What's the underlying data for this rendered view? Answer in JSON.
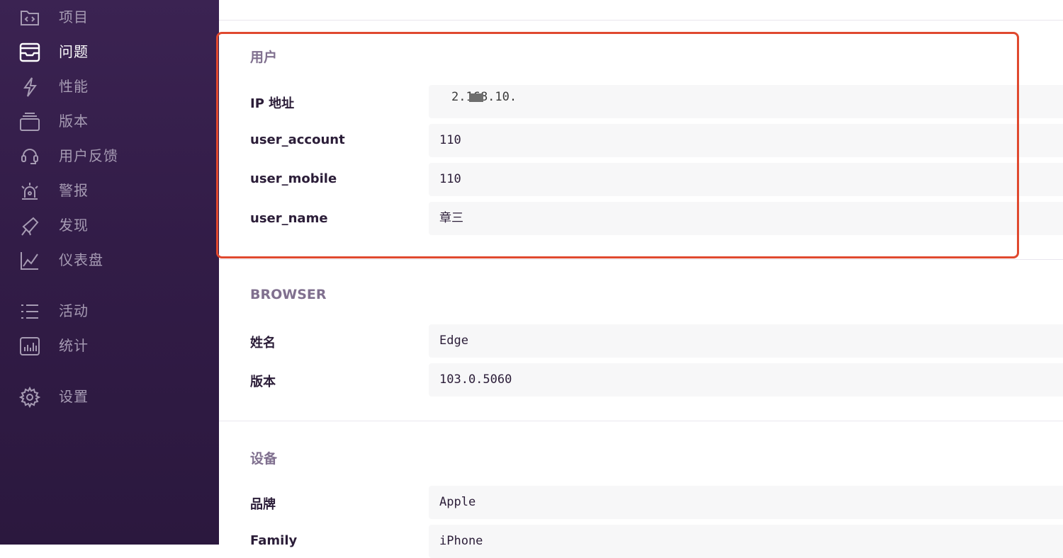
{
  "sidebar": {
    "items": [
      {
        "label": "项目",
        "icon": "code-folder-icon"
      },
      {
        "label": "问题",
        "icon": "inbox-icon",
        "active": true
      },
      {
        "label": "性能",
        "icon": "lightning-icon"
      },
      {
        "label": "版本",
        "icon": "releases-icon"
      },
      {
        "label": "用户反馈",
        "icon": "feedback-icon"
      },
      {
        "label": "警报",
        "icon": "siren-icon"
      },
      {
        "label": "发现",
        "icon": "telescope-icon"
      },
      {
        "label": "仪表盘",
        "icon": "graph-icon"
      },
      {
        "label": "活动",
        "icon": "list-icon"
      },
      {
        "label": "统计",
        "icon": "stats-icon"
      },
      {
        "label": "设置",
        "icon": "gear-icon"
      }
    ]
  },
  "sections": {
    "user": {
      "title": "用户",
      "fields": [
        {
          "key": "IP 地址",
          "value": "2.168.10."
        },
        {
          "key": "user_account",
          "value": "110"
        },
        {
          "key": "user_mobile",
          "value": "110"
        },
        {
          "key": "user_name",
          "value": "章三"
        }
      ]
    },
    "browser": {
      "title": "BROWSER",
      "fields": [
        {
          "key": "姓名",
          "value": "Edge"
        },
        {
          "key": "版本",
          "value": "103.0.5060"
        }
      ]
    },
    "device": {
      "title": "设备",
      "fields": [
        {
          "key": "品牌",
          "value": "Apple"
        },
        {
          "key": "Family",
          "value": "iPhone"
        }
      ]
    }
  },
  "colors": {
    "sidebar_bg": "#321c47",
    "highlight_border": "#e0492f",
    "value_bg": "#f7f7f8"
  }
}
